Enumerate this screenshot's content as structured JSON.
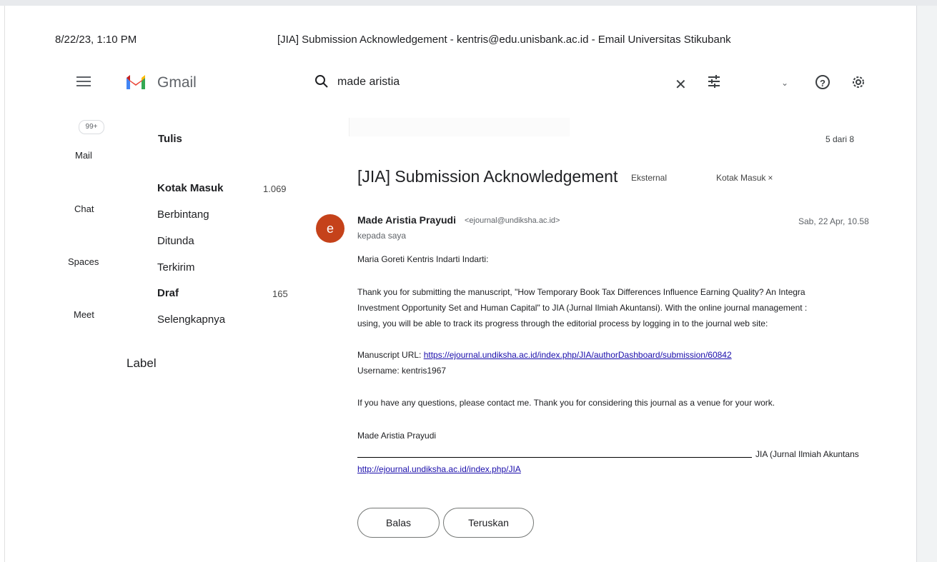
{
  "print_header": {
    "date": "8/22/23, 1:10 PM",
    "title": "[JIA] Submission Acknowledgement - kentris@edu.unisbank.ac.id - Email Universitas Stikubank"
  },
  "app": {
    "name": "Gmail"
  },
  "search": {
    "query": "made aristia"
  },
  "rail": {
    "badge": "99+",
    "items": [
      "Mail",
      "Chat",
      "Spaces",
      "Meet"
    ]
  },
  "nav": {
    "compose_label": "Tulis",
    "items": [
      {
        "label": "Kotak Masuk",
        "count": "1.069"
      },
      {
        "label": "Berbintang",
        "count": ""
      },
      {
        "label": "Ditunda",
        "count": ""
      },
      {
        "label": "Terkirim",
        "count": ""
      },
      {
        "label": "Draf",
        "count": "165"
      },
      {
        "label": "Selengkapnya",
        "count": ""
      }
    ],
    "labels_heading": "Label"
  },
  "pager": "5 dari 8",
  "email": {
    "subject": "[JIA] Submission Acknowledgement",
    "chips": {
      "external": "Eksternal",
      "inbox": "Kotak Masuk",
      "inbox_close": "×"
    },
    "avatar_letter": "e",
    "sender_name": "Made Aristia Prayudi",
    "sender_email": "<ejournal@undiksha.ac.id>",
    "recipient": "kepada saya",
    "date": "Sab, 22 Apr, 10.58",
    "body": {
      "greeting": "Maria Goreti Kentris Indarti Indarti:",
      "para1_line1": "Thank you for submitting the manuscript, \"How Temporary Book Tax Differences Influence Earning Quality? An Integra",
      "para1_line2": "Investment Opportunity Set and Human Capital\" to JIA (Jurnal Ilmiah Akuntansi). With the online journal management :",
      "para1_line3": "using, you will be able to track its progress through the editorial process by logging in to the journal web site:",
      "manuscript_url_label": "Manuscript URL: ",
      "manuscript_url": "https://ejournal.undiksha.ac.id/index.php/JIA/authorDashboard/submission/60842",
      "username_line": "Username: kentris1967",
      "para2": "If you have any questions, please contact me. Thank you for considering this journal as a venue for your work.",
      "signature_name": "Made Aristia Prayudi",
      "signature_org": "JIA (Jurnal Ilmiah Akuntans",
      "journal_url": "http://ejournal.undiksha.ac.id/index.php/JIA"
    },
    "actions": {
      "reply": "Balas",
      "forward": "Teruskan"
    }
  },
  "colors": {
    "avatar": "#c5421a",
    "link": "#1a0dab",
    "gmail_red": "#ea4335"
  }
}
